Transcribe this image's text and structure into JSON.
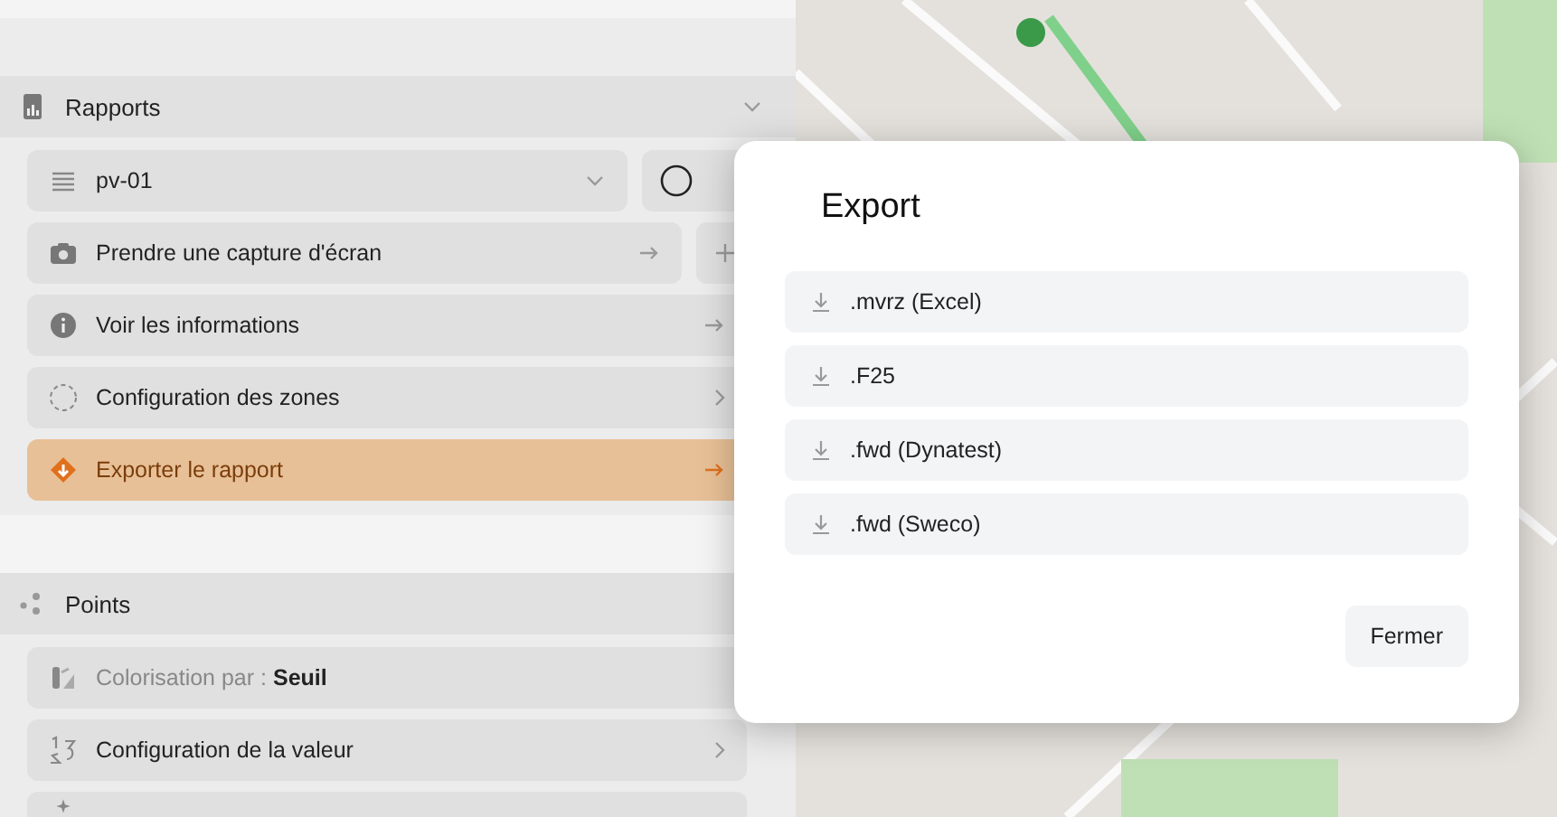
{
  "sections": [
    {
      "title": "Rapports",
      "expanded": true,
      "items": [
        {
          "kind": "select",
          "label": "pv-01"
        },
        {
          "kind": "link-add",
          "label": "Prendre une capture d'écran",
          "selected": false
        },
        {
          "kind": "link",
          "label": "Voir les informations",
          "selected": false
        },
        {
          "kind": "submenu",
          "label": "Configuration des zones",
          "selected": false
        },
        {
          "kind": "link",
          "label": "Exporter le rapport",
          "selected": true
        }
      ]
    },
    {
      "title": "Points",
      "items": [
        {
          "kind": "choice",
          "label": "Colorisation par :",
          "value": "Seuil"
        },
        {
          "kind": "submenu",
          "label": "Configuration de la valeur",
          "selected": false
        },
        {
          "kind": "stub"
        }
      ]
    }
  ],
  "dialog": {
    "title": "Export",
    "options": [
      ".mvrz (Excel)",
      ".F25",
      ".fwd (Dynatest)",
      ".fwd (Sweco)"
    ],
    "button": "Fermer"
  }
}
